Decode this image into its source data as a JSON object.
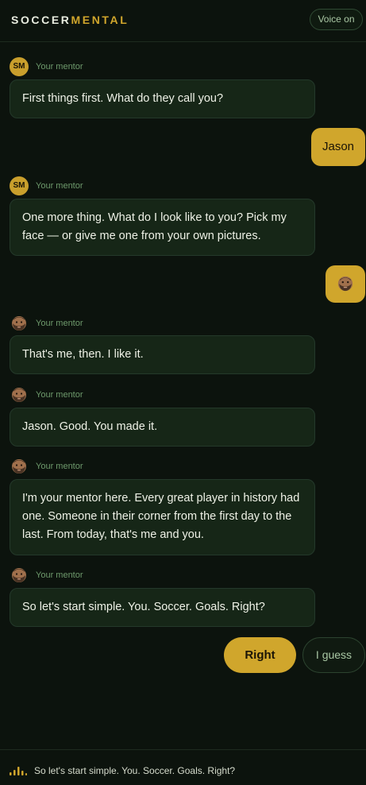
{
  "header": {
    "logo_part1": "SOCCER",
    "logo_part2": "MENTAL",
    "voice_button": "Voice on"
  },
  "avatar_initials": "SM",
  "mentor_label": "Your mentor",
  "messages": [
    {
      "text": "First things first. What do they call you?"
    },
    {
      "text": "One more thing. What do I look like to you? Pick my face — or give me one from your own pictures."
    },
    {
      "text": "That's me, then. I like it."
    },
    {
      "text": "Jason. Good. You made it."
    },
    {
      "text": "I'm your mentor here. Every great player in history had one. Someone in their corner from the first day to the last. From today, that's me and you."
    },
    {
      "text": "So let's start simple. You. Soccer. Goals. Right?"
    }
  ],
  "user_replies": {
    "name": "Jason",
    "face_choice": "bearded-face-icon"
  },
  "quick_replies": {
    "primary": "Right",
    "secondary": "I guess"
  },
  "footer": {
    "now_speaking": "So let's start simple. You. Soccer. Goals. Right?"
  },
  "colors": {
    "background": "#0c130d",
    "accent_gold": "#d0a62c",
    "bubble_bg": "#162617",
    "label_green": "#6e9a6c"
  }
}
